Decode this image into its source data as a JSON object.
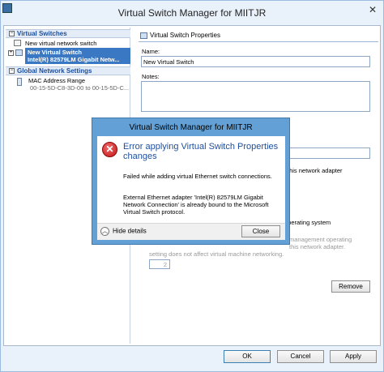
{
  "window": {
    "title": "Virtual Switch Manager for MIITJR",
    "close_glyph": "✕"
  },
  "tree": {
    "virtual_switches_header": "Virtual Switches",
    "new_switch": "New virtual network switch",
    "switch_name": "New Virtual Switch",
    "switch_adapter": "Intel(R) 82579LM Gigabit Netw...",
    "global_header": "Global Network Settings",
    "mac_label": "MAC Address Range",
    "mac_value": "00-15-5D-C8-3D-00 to 00-15-5D-C..."
  },
  "properties": {
    "title": "Virtual Switch Properties",
    "name_label": "Name:",
    "name_value": "New Virtual Switch",
    "notes_label": "Notes:",
    "behind_adapter_text": "this network adapter",
    "behind_os_text": "operating system",
    "behind_mgmt_text": "management operating",
    "behind_this_adapter": "this network adapter.",
    "behind_setting_text": "setting does not affect virtual machine networking.",
    "vlan_value": "2",
    "remove_label": "Remove"
  },
  "footer": {
    "ok_label": "OK",
    "cancel_label": "Cancel",
    "apply_label": "Apply"
  },
  "dialog": {
    "title": "Virtual Switch Manager for MIITJR",
    "heading": "Error applying Virtual Switch Properties changes",
    "message1": "Failed while adding virtual Ethernet switch connections.",
    "message2": "External Ethernet adapter 'Intel(R) 82579LM Gigabit Network Connection' is already bound to the Microsoft Virtual Switch protocol.",
    "hide_details_label": "Hide details",
    "close_label": "Close",
    "icon_glyph": "✕"
  },
  "colors": {
    "accent": "#3b78c3",
    "dialog_frame": "#62a0d6",
    "heading_blue": "#1e4f9c",
    "error_red": "#c41515"
  }
}
